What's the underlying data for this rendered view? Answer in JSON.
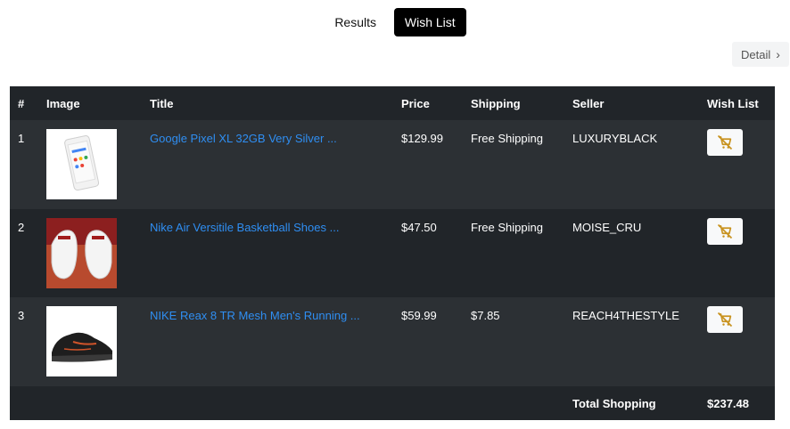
{
  "tabs": [
    {
      "label": "Results",
      "active": false
    },
    {
      "label": "Wish List",
      "active": true
    }
  ],
  "detail_button": {
    "label": "Detail"
  },
  "table": {
    "headers": {
      "num": "#",
      "image": "Image",
      "title": "Title",
      "price": "Price",
      "shipping": "Shipping",
      "seller": "Seller",
      "wishlist": "Wish List"
    },
    "rows": [
      {
        "num": "1",
        "title": "Google Pixel XL 32GB Very Silver ...",
        "price": "$129.99",
        "shipping": "Free Shipping",
        "seller": "LUXURYBLACK",
        "image_icon": "phone-image"
      },
      {
        "num": "2",
        "title": "Nike Air Versitile Basketball Shoes ...",
        "price": "$47.50",
        "shipping": "Free Shipping",
        "seller": "MOISE_CRU",
        "image_icon": "white-sneakers-image"
      },
      {
        "num": "3",
        "title": "NIKE Reax 8 TR Mesh Men's Running ...",
        "price": "$59.99",
        "shipping": "$7.85",
        "seller": "REACH4THESTYLE",
        "image_icon": "black-sneaker-image"
      }
    ],
    "footer": {
      "label": "Total Shopping",
      "value": "$237.48"
    }
  },
  "colors": {
    "link": "#2f8ef2",
    "cart_icon": "#c8921e",
    "active_tab": "#000000"
  }
}
